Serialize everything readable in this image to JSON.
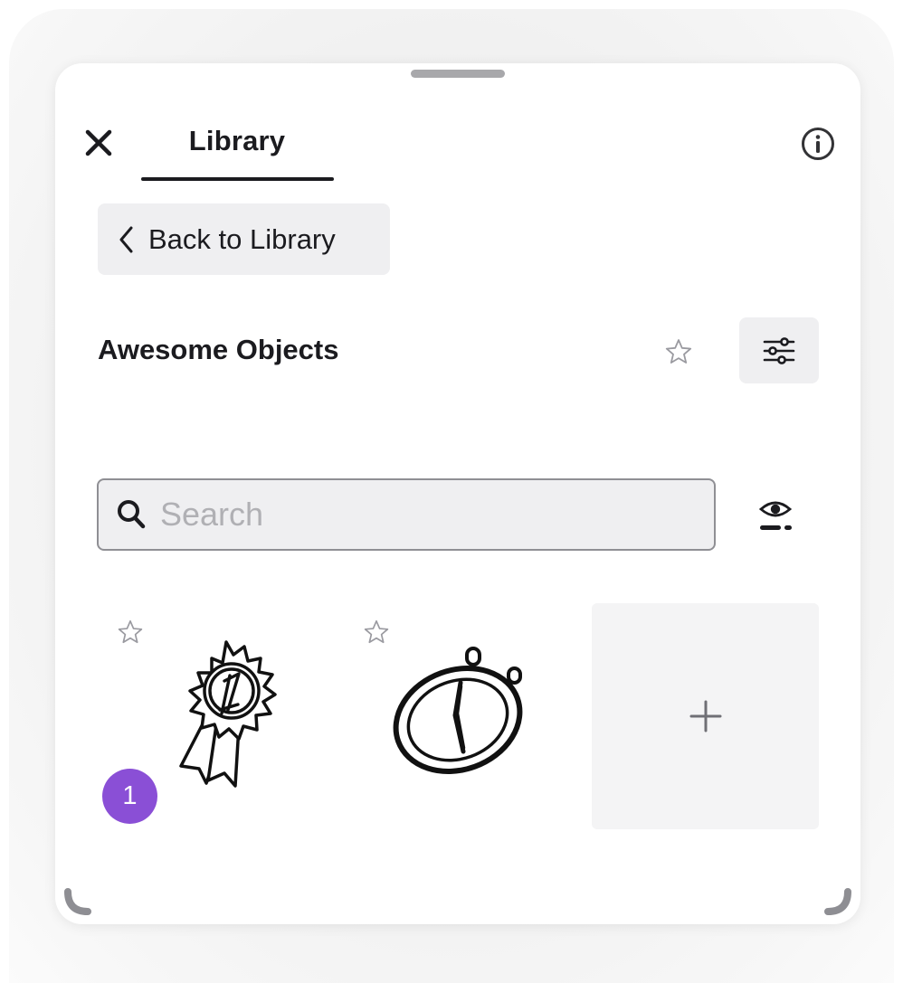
{
  "header": {
    "tab_label": "Library"
  },
  "nav": {
    "back_label": "Back to Library"
  },
  "collection": {
    "title": "Awesome Objects",
    "favorited": false
  },
  "search": {
    "placeholder": "Search",
    "value": ""
  },
  "items": [
    {
      "icon": "first-place-ribbon-icon",
      "favorited": false,
      "badge": "1"
    },
    {
      "icon": "stopwatch-icon",
      "favorited": false
    }
  ],
  "colors": {
    "badge": "#8a4fd6",
    "text": "#1b1b1f",
    "button_bg": "#efeff1"
  }
}
